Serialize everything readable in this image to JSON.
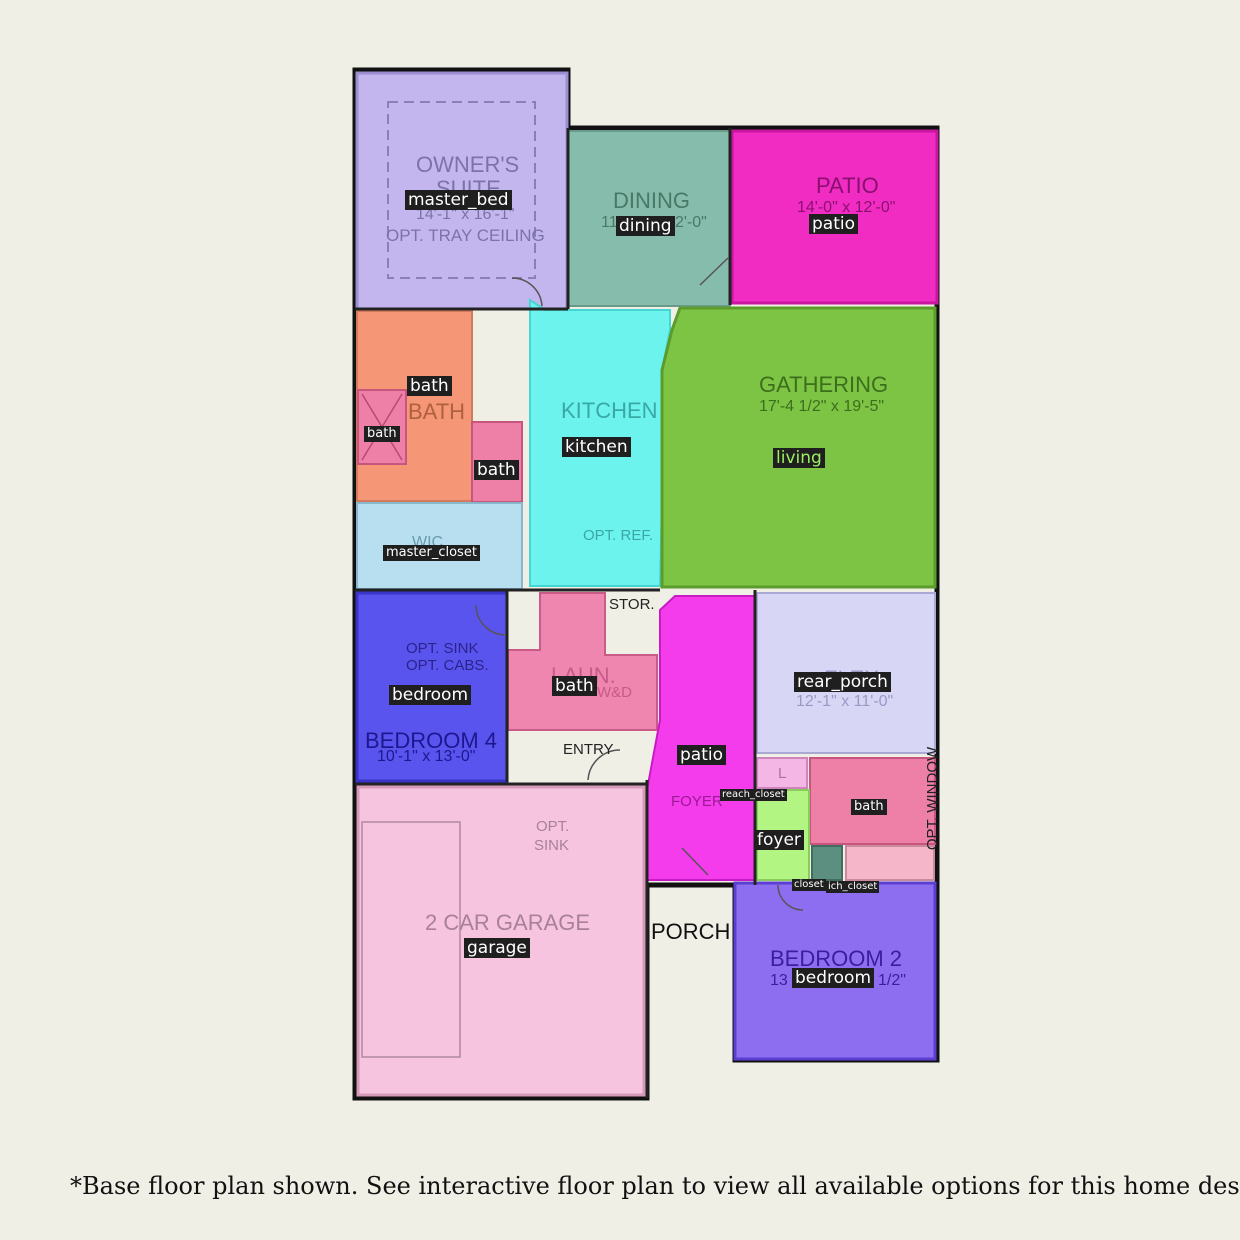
{
  "plan_text": {
    "owners_suite": "OWNER'S",
    "owners_suite_2": "SUITE",
    "owners_dim": "14'-1\" x 16'-1\"",
    "owners_ceiling": "OPT. TRAY CEILING",
    "dining": "DINING",
    "dining_dim_a": "11",
    "dining_dim_b": "2'-0\"",
    "patio": "PATIO",
    "patio_dim": "14'-0\" x 12'-0\"",
    "gathering": "GATHERING",
    "gathering_dim": "17'-4 1/2\" x 19'-5\"",
    "kitchen": "KITCHEN",
    "bath": "BATH",
    "opt_ref": "OPT. REF.",
    "wic": "WIC",
    "stor": "STOR.",
    "laun": "LAUN.",
    "wd": "W&D",
    "opt_sink": "OPT. SINK",
    "opt_cabs": "OPT. CABS.",
    "bedroom4": "BEDROOM 4",
    "bedroom4_dim": "10'-1\" x 13'-0\"",
    "entry": "ENTRY",
    "flex": "FLEX",
    "flex_dim": "12'-1\" x 11'-0\"",
    "foyer": "FOYER",
    "opt_window": "OPT. WINDOW",
    "garage_opt_sink_1": "OPT.",
    "garage_opt_sink_2": "SINK",
    "garage": "2 CAR GARAGE",
    "porch": "PORCH",
    "bedroom2": "BEDROOM 2",
    "bedroom2_dim_a": "13",
    "bedroom2_dim_b": "1/2\"",
    "wic_l": "L"
  },
  "labels": {
    "master_bed": "master_bed",
    "dining": "dining",
    "patio_top": "patio",
    "bath_main": "bath",
    "bath_shower": "bath",
    "bath_wc": "bath",
    "kitchen": "kitchen",
    "living": "living",
    "master_closet": "master_closet",
    "bedroom4": "bedroom",
    "bath_laundry": "bath",
    "patio_foyer": "patio",
    "rear_porch": "rear_porch",
    "reach_closet_1": "reach_closet",
    "bath_2": "bath",
    "foyer": "foyer",
    "closet": "closet",
    "reach_closet_2": "ich_closet",
    "garage": "garage",
    "bedroom2": "bedroom"
  },
  "footnote": "*Base floor plan shown.  See interactive floor plan to view all available options for this home design.",
  "colors": {
    "master_bed": "#c0b2ee",
    "dining": "#86bcab",
    "patio": "#f02cc2",
    "bath": "#f59676",
    "bath_pink": "#ee7fa6",
    "kitchen": "#6cf3ee",
    "living": "#7dc444",
    "master_closet": "#b7dff0",
    "bedroom4": "#5a54ee",
    "laundry": "#ee86b0",
    "foyer_patio": "#f43cec",
    "flex": "#d7d6f5",
    "foyer": "#b2f583",
    "garage": "#f7c4e0",
    "bedroom2": "#8e6ef0",
    "closet": "#5d8f80"
  }
}
